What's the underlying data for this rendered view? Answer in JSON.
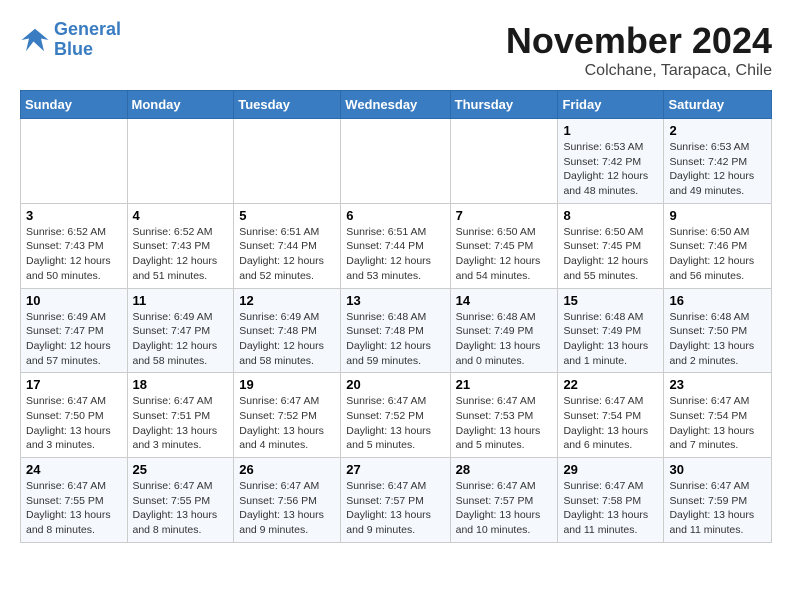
{
  "logo": {
    "line1": "General",
    "line2": "Blue"
  },
  "title": "November 2024",
  "location": "Colchane, Tarapaca, Chile",
  "days_of_week": [
    "Sunday",
    "Monday",
    "Tuesday",
    "Wednesday",
    "Thursday",
    "Friday",
    "Saturday"
  ],
  "weeks": [
    [
      {
        "day": "",
        "info": ""
      },
      {
        "day": "",
        "info": ""
      },
      {
        "day": "",
        "info": ""
      },
      {
        "day": "",
        "info": ""
      },
      {
        "day": "",
        "info": ""
      },
      {
        "day": "1",
        "info": "Sunrise: 6:53 AM\nSunset: 7:42 PM\nDaylight: 12 hours and 48 minutes."
      },
      {
        "day": "2",
        "info": "Sunrise: 6:53 AM\nSunset: 7:42 PM\nDaylight: 12 hours and 49 minutes."
      }
    ],
    [
      {
        "day": "3",
        "info": "Sunrise: 6:52 AM\nSunset: 7:43 PM\nDaylight: 12 hours and 50 minutes."
      },
      {
        "day": "4",
        "info": "Sunrise: 6:52 AM\nSunset: 7:43 PM\nDaylight: 12 hours and 51 minutes."
      },
      {
        "day": "5",
        "info": "Sunrise: 6:51 AM\nSunset: 7:44 PM\nDaylight: 12 hours and 52 minutes."
      },
      {
        "day": "6",
        "info": "Sunrise: 6:51 AM\nSunset: 7:44 PM\nDaylight: 12 hours and 53 minutes."
      },
      {
        "day": "7",
        "info": "Sunrise: 6:50 AM\nSunset: 7:45 PM\nDaylight: 12 hours and 54 minutes."
      },
      {
        "day": "8",
        "info": "Sunrise: 6:50 AM\nSunset: 7:45 PM\nDaylight: 12 hours and 55 minutes."
      },
      {
        "day": "9",
        "info": "Sunrise: 6:50 AM\nSunset: 7:46 PM\nDaylight: 12 hours and 56 minutes."
      }
    ],
    [
      {
        "day": "10",
        "info": "Sunrise: 6:49 AM\nSunset: 7:47 PM\nDaylight: 12 hours and 57 minutes."
      },
      {
        "day": "11",
        "info": "Sunrise: 6:49 AM\nSunset: 7:47 PM\nDaylight: 12 hours and 58 minutes."
      },
      {
        "day": "12",
        "info": "Sunrise: 6:49 AM\nSunset: 7:48 PM\nDaylight: 12 hours and 58 minutes."
      },
      {
        "day": "13",
        "info": "Sunrise: 6:48 AM\nSunset: 7:48 PM\nDaylight: 12 hours and 59 minutes."
      },
      {
        "day": "14",
        "info": "Sunrise: 6:48 AM\nSunset: 7:49 PM\nDaylight: 13 hours and 0 minutes."
      },
      {
        "day": "15",
        "info": "Sunrise: 6:48 AM\nSunset: 7:49 PM\nDaylight: 13 hours and 1 minute."
      },
      {
        "day": "16",
        "info": "Sunrise: 6:48 AM\nSunset: 7:50 PM\nDaylight: 13 hours and 2 minutes."
      }
    ],
    [
      {
        "day": "17",
        "info": "Sunrise: 6:47 AM\nSunset: 7:50 PM\nDaylight: 13 hours and 3 minutes."
      },
      {
        "day": "18",
        "info": "Sunrise: 6:47 AM\nSunset: 7:51 PM\nDaylight: 13 hours and 3 minutes."
      },
      {
        "day": "19",
        "info": "Sunrise: 6:47 AM\nSunset: 7:52 PM\nDaylight: 13 hours and 4 minutes."
      },
      {
        "day": "20",
        "info": "Sunrise: 6:47 AM\nSunset: 7:52 PM\nDaylight: 13 hours and 5 minutes."
      },
      {
        "day": "21",
        "info": "Sunrise: 6:47 AM\nSunset: 7:53 PM\nDaylight: 13 hours and 5 minutes."
      },
      {
        "day": "22",
        "info": "Sunrise: 6:47 AM\nSunset: 7:54 PM\nDaylight: 13 hours and 6 minutes."
      },
      {
        "day": "23",
        "info": "Sunrise: 6:47 AM\nSunset: 7:54 PM\nDaylight: 13 hours and 7 minutes."
      }
    ],
    [
      {
        "day": "24",
        "info": "Sunrise: 6:47 AM\nSunset: 7:55 PM\nDaylight: 13 hours and 8 minutes."
      },
      {
        "day": "25",
        "info": "Sunrise: 6:47 AM\nSunset: 7:55 PM\nDaylight: 13 hours and 8 minutes."
      },
      {
        "day": "26",
        "info": "Sunrise: 6:47 AM\nSunset: 7:56 PM\nDaylight: 13 hours and 9 minutes."
      },
      {
        "day": "27",
        "info": "Sunrise: 6:47 AM\nSunset: 7:57 PM\nDaylight: 13 hours and 9 minutes."
      },
      {
        "day": "28",
        "info": "Sunrise: 6:47 AM\nSunset: 7:57 PM\nDaylight: 13 hours and 10 minutes."
      },
      {
        "day": "29",
        "info": "Sunrise: 6:47 AM\nSunset: 7:58 PM\nDaylight: 13 hours and 11 minutes."
      },
      {
        "day": "30",
        "info": "Sunrise: 6:47 AM\nSunset: 7:59 PM\nDaylight: 13 hours and 11 minutes."
      }
    ]
  ]
}
